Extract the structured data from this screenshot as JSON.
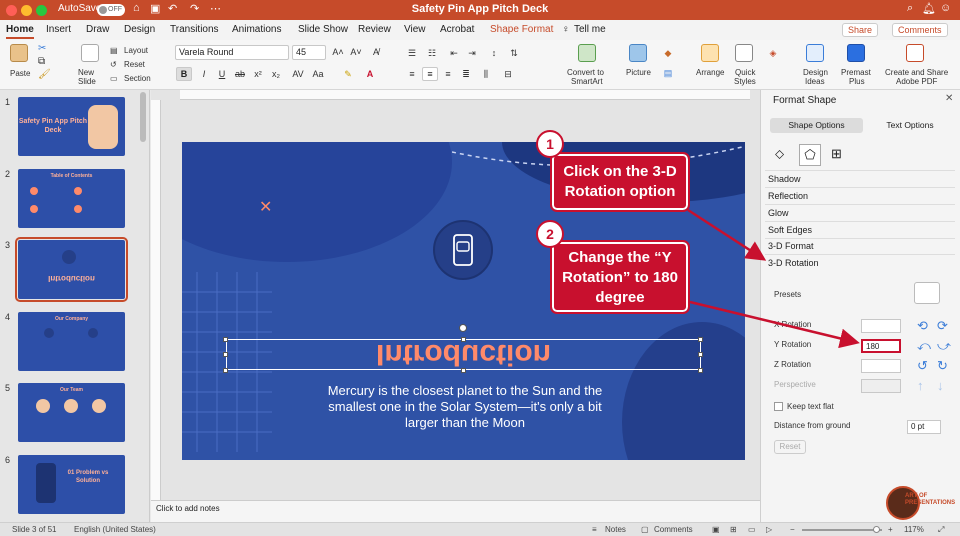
{
  "window": {
    "title": "Safety Pin App Pitch Deck",
    "autosave_label": "AutoSave",
    "autosave_state": "OFF"
  },
  "tabs": [
    "Home",
    "Insert",
    "Draw",
    "Design",
    "Transitions",
    "Animations",
    "Slide Show",
    "Review",
    "View",
    "Acrobat",
    "Shape Format",
    "Tell me"
  ],
  "header_buttons": {
    "share": "Share",
    "comments": "Comments"
  },
  "ribbon": {
    "paste": "Paste",
    "new_slide_1": "New",
    "new_slide_2": "Slide",
    "layout": "Layout",
    "reset": "Reset",
    "section": "Section",
    "font_name": "Varela Round",
    "font_size": "45",
    "convert_1": "Convert to",
    "convert_2": "SmartArt",
    "picture": "Picture",
    "arrange": "Arrange",
    "quick_1": "Quick",
    "quick_2": "Styles",
    "design_1": "Design",
    "design_2": "Ideas",
    "premast_1": "Premast",
    "premast_2": "Plus",
    "adobe_1": "Create and Share",
    "adobe_2": "Adobe PDF"
  },
  "thumbnails": [
    {
      "num": "1",
      "title": "Safety Pin App Pitch Deck"
    },
    {
      "num": "2",
      "title": "Table of Contents"
    },
    {
      "num": "3",
      "title": "Introduction"
    },
    {
      "num": "4",
      "title": "Our Company"
    },
    {
      "num": "5",
      "title": "Our Team"
    },
    {
      "num": "6",
      "title": "01 Problem vs Solution"
    }
  ],
  "slide": {
    "mirrored_title": "Introduction",
    "body": "Mercury is the closest planet to the Sun and the smallest one in the Solar System—it's only a bit larger than the Moon"
  },
  "notes_placeholder": "Click to add notes",
  "status": {
    "slide_info": "Slide 3 of 51",
    "language": "English (United States)",
    "notes": "Notes",
    "comments": "Comments",
    "zoom": "117%"
  },
  "format_shape": {
    "title": "Format Shape",
    "tab_shape": "Shape Options",
    "tab_text": "Text Options",
    "sections": [
      "Shadow",
      "Reflection",
      "Glow",
      "Soft Edges",
      "3-D Format",
      "3-D Rotation"
    ],
    "presets": "Presets",
    "x_rot": "X Rotation",
    "y_rot": "Y Rotation",
    "y_value": "180",
    "z_rot": "Z Rotation",
    "perspective": "Perspective",
    "keep_flat": "Keep text flat",
    "distance": "Distance from ground",
    "distance_value": "0 pt",
    "reset": "Reset"
  },
  "callouts": {
    "one_num": "1",
    "one_text": "Click on the 3-D Rotation option",
    "two_num": "2",
    "two_text": "Change the “Y Rotation” to 180 degree"
  },
  "watermark": {
    "line1": "ART OF",
    "line2": "PRESENTATIONS"
  },
  "colors": {
    "brand": "#c64b2a",
    "slide_bg": "#2f52a6",
    "accent_text": "#ff8a6a",
    "callout": "#c8102e"
  }
}
